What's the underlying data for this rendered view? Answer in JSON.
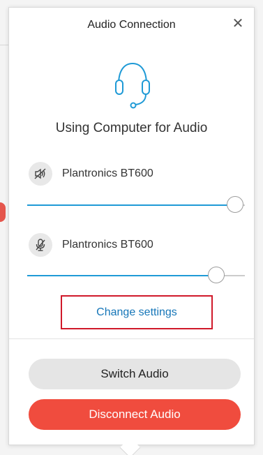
{
  "dialog": {
    "title": "Audio Connection",
    "close_icon": "close-icon",
    "status_text": "Using Computer for Audio",
    "hero_icon": "headset-icon"
  },
  "devices": [
    {
      "kind": "speaker",
      "icon": "speaker-muted-icon",
      "label": "Plantronics BT600",
      "level": 1.0
    },
    {
      "kind": "microphone",
      "icon": "microphone-muted-icon",
      "label": "Plantronics BT600",
      "level": 0.91
    }
  ],
  "links": {
    "change_settings": "Change settings"
  },
  "buttons": {
    "switch_audio": "Switch Audio",
    "disconnect_audio": "Disconnect Audio"
  },
  "colors": {
    "accent": "#1f9ad6",
    "link": "#1676b8",
    "danger": "#f04c3e",
    "highlight_border": "#d0192a"
  }
}
